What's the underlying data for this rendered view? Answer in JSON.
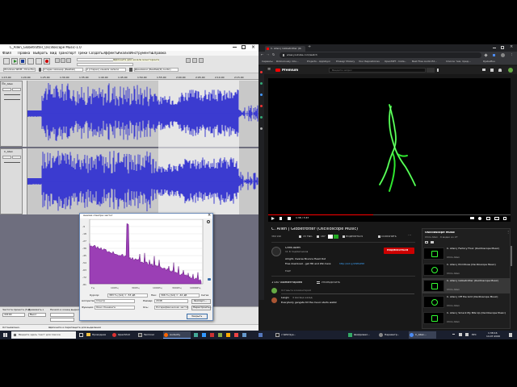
{
  "audacity": {
    "title": "C_Allen_Globetrotter_Oscilloscope Music-1.0",
    "menu": [
      "Файл",
      "Правка",
      "Выбрать",
      "Вид",
      "Транспорт",
      "Треки",
      "Создать",
      "Эффекты",
      "Анализ",
      "Инструменты",
      "Справка"
    ],
    "timeline": [
      "1:15.00",
      "1:20.00",
      "1:25.00",
      "1:30.00",
      "1:35.00",
      "1:40.00",
      "1:45.00",
      "1:50.00",
      "1:55.00",
      "2:00.00",
      "2:05.00",
      "2:10.00",
      "2:15.00"
    ],
    "track1_name": "C_Allen",
    "track2_name": "C_Allen",
    "device_in": "Windows WDM / DirectSound",
    "device_mic": "Стерео микшер (Realtek)",
    "device_channels": "2 (стерео) канала записи",
    "device_out": "Динамики (Realtek(R) Audio)",
    "tooltip": "Щёлкните для начала мониторинга",
    "bottom": {
      "rate_label": "Частота проекта (Гц)",
      "snap_label": "Привязать к",
      "rate_value": "44100",
      "snap_value": "Выкл",
      "start_label": "Начало и конец выделения",
      "status": "Остановлено.",
      "hint": "Щёлкните и перетащите для выделения"
    }
  },
  "spectrum": {
    "title": "Анализ спектра частот",
    "cursor_label": "Курсор:",
    "cursor_value": "383 Гц (G4) = -53 дБ",
    "peak_label": "Пик:",
    "peak_value": "396 Гц (G4) = -42 дБ",
    "algo_label": "Алгоритм:",
    "algo_value": "Спектр",
    "size_label": "Размер:",
    "size_value": "2048",
    "func_label": "Функция:",
    "func_value": "Окно Хэннинга",
    "axis_label": "Ось:",
    "axis_value": "Логарифмическая частота",
    "export": "Экспорт...",
    "replot": "Перестроить...",
    "close": "Закрыть",
    "grid": "Сетка",
    "xticks": [
      "Гц",
      "100Гц",
      "300Гц",
      "1000Гц",
      "3000Гц",
      "10000Гц"
    ],
    "yticks": [
      "-9",
      "-18",
      "-27",
      "-36",
      "-45",
      "-54",
      "-63",
      "-72",
      "-81"
    ]
  },
  "browser": {
    "tabs": [
      "C. Allen | Globetrotter (Os..."
    ],
    "url": "www.youtube.com/watch",
    "bookmarks": [
      "Сервисы",
      "Ridiculously intu...",
      "Projects - AppVeyor",
      "Pinaagr Mozary",
      "Your Repositories",
      "OpenMPT - Insta...",
      "Best Free Audio Ed...",
      "Список тем, пред...",
      "DjabePlus"
    ],
    "search_placeholder": "Введите запрос",
    "premium": "Premium",
    "video_time": "1:38 / 3:47",
    "title": "C. Allen | Globetrotter (Oscilloscope Music)",
    "views": "389 990",
    "likes": "15 ТЫС.",
    "dislikes": "187",
    "share": "ПОДЕЛИТЬСЯ",
    "save": "СОХРАНИТЬ",
    "channel": "Chris Allen",
    "subs": "11 К подписчиков",
    "subscribe": "ПОДПИСАТЬСЯ",
    "desc1": "Alright, Inverse Bounce Head Out",
    "desc2": "Free download - get HD and Win here:",
    "desc_link": "http://bit.ly/2NHAPDt",
    "more": "ЕЩЁ",
    "comments_count": "1 057 комментариев",
    "sort": "УПОРЯДОЧИТЬ",
    "comment_placeholder": "Оставьте комментарий",
    "commenter": "Laoglo",
    "comment_meta": "4 месяца назад",
    "comment_text": "Everybody gangsta till the music starts walkin",
    "playlist_title": "Oscilloscope Music",
    "playlist_sub": "Chris Allen · 9 видео из 27",
    "playlist": [
      {
        "title": "C. Allen | Factory Floor (Oscilloscope Music)",
        "ch": "Chris Allen"
      },
      {
        "title": "C. Allen | Primitives (Oscilloscope Music)",
        "ch": "Chris Allen"
      },
      {
        "title": "C. Allen | Globetrotter (Oscilloscope Music)",
        "ch": "Chris Allen"
      },
      {
        "title": "C. Allen | Off the Grid (Oscilloscope Music)",
        "ch": "Chris Allen"
      },
      {
        "title": "C. Allen | Smack My Bits Up (Oscilloscope Music)",
        "ch": "Chris Allen"
      }
    ]
  },
  "taskbar": {
    "search": "Введите здесь текст для поиска",
    "apps": [
      "Проводник",
      "OpenShot",
      "Terminal",
      "Audacity"
    ],
    "apps_right": [
      "c:\\Win\\Sys...",
      "Шифровал...",
      "Параметр...",
      "C_Allen..."
    ],
    "time": "1:38:16",
    "date": "14.07.2020",
    "lang": "РУС"
  },
  "colors": {
    "waveform": "#3b3bd0",
    "spectrum": "#9b3fb5",
    "youtube_red": "#ff0000",
    "scope_green": "#33ff33",
    "taskbar": "#1a1f2e"
  }
}
